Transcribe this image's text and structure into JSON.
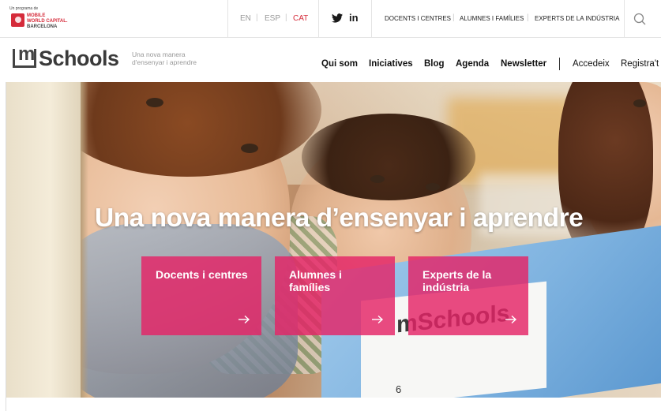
{
  "topbar": {
    "program_label": "Un programa de",
    "mwc_line1": "MOBILE",
    "mwc_line2": "WORLD CAPITAL.",
    "mwc_line3": "BARCELONA",
    "languages": [
      {
        "code": "EN",
        "active": false
      },
      {
        "code": "ESP",
        "active": false
      },
      {
        "code": "CAT",
        "active": true
      }
    ],
    "social": [
      {
        "name": "twitter-icon",
        "text": ""
      },
      {
        "name": "linkedin-icon",
        "text": "in"
      }
    ],
    "links": [
      "DOCENTS I CENTRES",
      "ALUMNES I FAMÍLIES",
      "EXPERTS DE LA INDÚSTRIA"
    ],
    "search_icon": "search-icon",
    "accent_color": "#d52b3a"
  },
  "header": {
    "logo_m": "m",
    "logo_text": "Schools",
    "tagline_line1": "Una nova manera",
    "tagline_line2": "d'ensenyar i aprendre",
    "nav": [
      "Qui som",
      "Iniciatives",
      "Blog",
      "Agenda",
      "Newsletter"
    ],
    "account": [
      "Accedeix",
      "Registra't"
    ]
  },
  "hero": {
    "title": "Una nova manera d’ensenyar i aprendre",
    "box_logo": "mSchools",
    "box_number": "6",
    "cards": [
      {
        "label": "Docents i centres",
        "arrow": "→"
      },
      {
        "label": "Alumnes i famílies",
        "arrow": "→"
      },
      {
        "label": "Experts de la indústria",
        "arrow": "→"
      }
    ],
    "card_color": "#e42367"
  }
}
